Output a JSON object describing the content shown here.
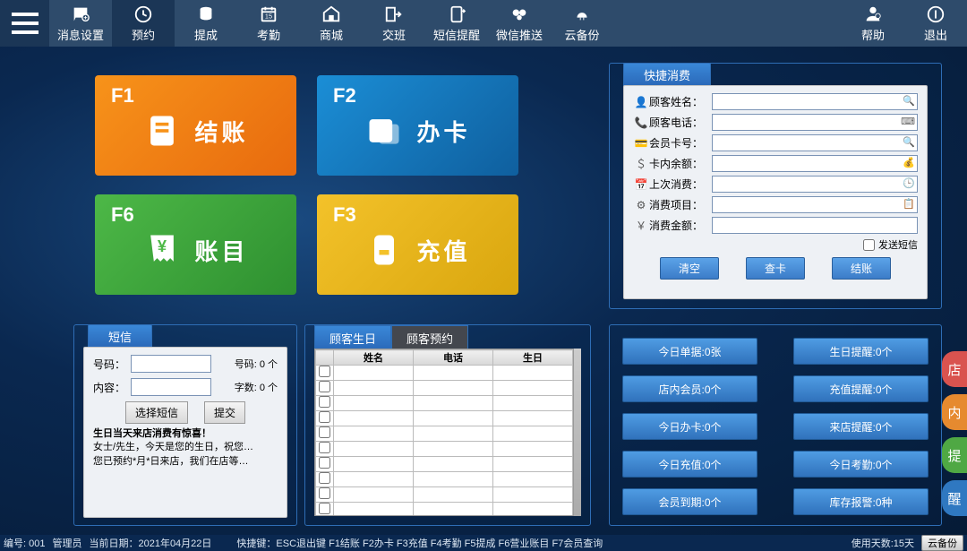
{
  "topbar": {
    "items": [
      {
        "label": "消息设置",
        "active": false
      },
      {
        "label": "预约",
        "active": true
      },
      {
        "label": "提成",
        "active": false
      },
      {
        "label": "考勤",
        "active": false
      },
      {
        "label": "商城",
        "active": false
      },
      {
        "label": "交班",
        "active": false
      },
      {
        "label": "短信提醒",
        "active": false
      },
      {
        "label": "微信推送",
        "active": false
      },
      {
        "label": "云备份",
        "active": false
      }
    ],
    "right": [
      {
        "label": "帮助"
      },
      {
        "label": "退出"
      }
    ]
  },
  "tiles": {
    "checkout": {
      "fkey": "F1",
      "label": "结账"
    },
    "newcard": {
      "fkey": "F2",
      "label": "办卡"
    },
    "ledger": {
      "fkey": "F6",
      "label": "账目"
    },
    "recharge": {
      "fkey": "F3",
      "label": "充值"
    }
  },
  "quick": {
    "title": "快捷消费",
    "rows": [
      {
        "icon": "👤",
        "label": "顾客姓名：",
        "suffix": "🔍"
      },
      {
        "icon": "📞",
        "label": "顾客电话：",
        "suffix": "⌨"
      },
      {
        "icon": "💳",
        "label": "会员卡号：",
        "suffix": "🔍"
      },
      {
        "icon": "＄",
        "label": "卡内余额：",
        "suffix": "💰"
      },
      {
        "icon": "📅",
        "label": "上次消费：",
        "suffix": "🕒"
      },
      {
        "icon": "⚙",
        "label": "消费项目：",
        "suffix": "📋"
      },
      {
        "icon": "￥",
        "label": "消费金额：",
        "suffix": ""
      }
    ],
    "send_sms_label": "发送短信",
    "actions": {
      "clear": "清空",
      "check": "查卡",
      "settle": "结账"
    }
  },
  "stats": [
    {
      "label": "今日单据:0张"
    },
    {
      "label": "生日提醒:0个"
    },
    {
      "label": "店内会员:0个"
    },
    {
      "label": "充值提醒:0个"
    },
    {
      "label": "今日办卡:0个"
    },
    {
      "label": "来店提醒:0个"
    },
    {
      "label": "今日充值:0个"
    },
    {
      "label": "今日考勤:0个"
    },
    {
      "label": "会员到期:0个"
    },
    {
      "label": "库存报警:0种"
    }
  ],
  "side_tabs": [
    "店",
    "内",
    "提",
    "醒"
  ],
  "sms": {
    "title": "短信",
    "number_label": "号码：",
    "number_count": "号码: 0 个",
    "content_label": "内容：",
    "word_count": "字数: 0 个",
    "select_btn": "选择短信",
    "submit_btn": "提交",
    "line1": "生日当天来店消费有惊喜！",
    "line2": "女士/先生，今天是您的生日，祝您…",
    "line3": "您已预约*月*日来店，我们在店等…"
  },
  "table": {
    "tabs": [
      "顾客生日",
      "顾客预约"
    ],
    "headers": [
      "",
      "姓名",
      "电话",
      "生日"
    ],
    "rows": 10
  },
  "status": {
    "id": "编号: 001",
    "admin": "管理员",
    "date": "当前日期：2021年04月22日",
    "shortcuts": "快捷键：ESC退出键  F1结账  F2办卡  F3充值  F4考勤  F5提成  F6营业账目  F7会员查询",
    "days": "使用天数:15天",
    "backup_btn": "云备份"
  }
}
